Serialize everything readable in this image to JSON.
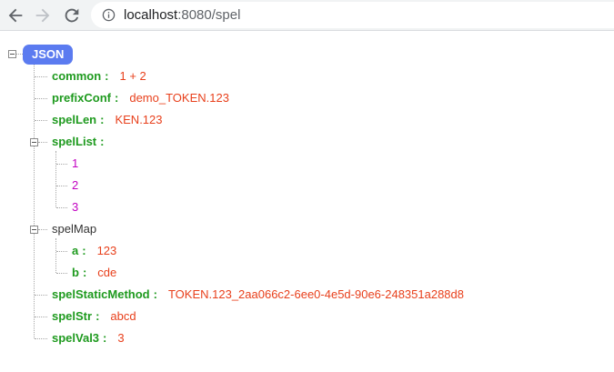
{
  "browser": {
    "url_host": "localhost",
    "url_rest": ":8080/spel",
    "back_icon": "arrow-left-icon",
    "forward_icon": "arrow-right-icon",
    "reload_icon": "reload-icon",
    "info_icon": "info-circle-icon"
  },
  "tree": {
    "root_label": "JSON",
    "colon": ":",
    "common": {
      "key": "common",
      "value": "1 + 2"
    },
    "prefixConf": {
      "key": "prefixConf",
      "value": "demo_TOKEN.123"
    },
    "spelLen": {
      "key": "spelLen",
      "value": "KEN.123"
    },
    "spelList": {
      "key": "spelList",
      "items": [
        "1",
        "2",
        "3"
      ]
    },
    "spelMap": {
      "key": "spelMap",
      "a": {
        "key": "a",
        "value": "123"
      },
      "b": {
        "key": "b",
        "value": "cde"
      }
    },
    "spelStaticMethod": {
      "key": "spelStaticMethod",
      "value": "TOKEN.123_2aa066c2-6ee0-4e5d-90e6-248351a288d8"
    },
    "spelStr": {
      "key": "spelStr",
      "value": "abcd"
    },
    "spelVal3": {
      "key": "spelVal3",
      "value": "3"
    }
  },
  "colors": {
    "key_green": "#1e9a1e",
    "string_red": "#e8401c",
    "number_magenta": "#c200c2",
    "root_blue": "#5b7bf0"
  }
}
